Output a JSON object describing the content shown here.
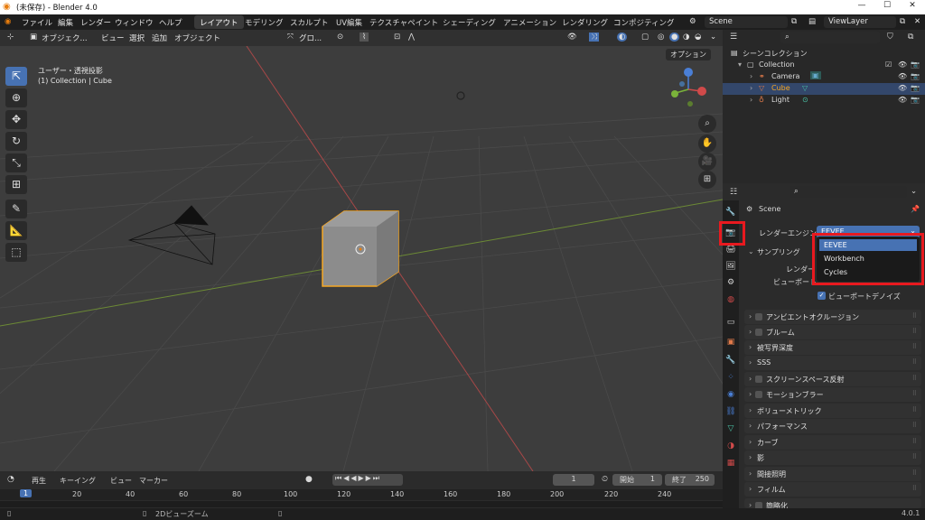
{
  "window": {
    "title": "(未保存) - Blender 4.0",
    "controls": [
      "—",
      "☐",
      "✕"
    ]
  },
  "menu": [
    "ファイル",
    "編集",
    "レンダー",
    "ウィンドウ",
    "ヘルプ"
  ],
  "workspaces": [
    "レイアウト",
    "モデリング",
    "スカルプト",
    "UV編集",
    "テクスチャペイント",
    "シェーディング",
    "アニメーション",
    "レンダリング",
    "コンポジティング"
  ],
  "active_workspace": "レイアウト",
  "scene_name": "Scene",
  "view_layer": "ViewLayer",
  "viewport_header": {
    "mode": "オブジェク...",
    "items": [
      "ビュー",
      "選択",
      "追加",
      "オブジェクト"
    ],
    "transform": "グロ..."
  },
  "viewport": {
    "view_name": "ユーザー・透視投影",
    "context": "(1) Collection | Cube",
    "options_label": "オプション"
  },
  "outliner": {
    "root": "シーンコレクション",
    "collection": "Collection",
    "items": [
      {
        "name": "Camera",
        "color": "#e07a4a"
      },
      {
        "name": "Cube",
        "color": "#e07a4a"
      },
      {
        "name": "Light",
        "color": "#e07a4a"
      }
    ]
  },
  "properties": {
    "scene": "Scene",
    "engine_label": "レンダーエンジン",
    "engine_value": "EEVEE",
    "engine_options": [
      "EEVEE",
      "Workbench",
      "Cycles"
    ],
    "sampling": "サンプリング",
    "render_label": "レンダー",
    "viewport_label": "ビューポート",
    "denoise": "ビューポートデノイズ",
    "panels": [
      {
        "label": "アンビエントオクルージョン",
        "checkbox": true
      },
      {
        "label": "ブルーム",
        "checkbox": true
      },
      {
        "label": "被写界深度",
        "checkbox": false
      },
      {
        "label": "SSS",
        "checkbox": false
      },
      {
        "label": "スクリーンスペース反射",
        "checkbox": true
      },
      {
        "label": "モーションブラー",
        "checkbox": true
      },
      {
        "label": "ボリューメトリック",
        "checkbox": false
      },
      {
        "label": "パフォーマンス",
        "checkbox": false
      },
      {
        "label": "カーブ",
        "checkbox": false
      },
      {
        "label": "影",
        "checkbox": false
      },
      {
        "label": "間接照明",
        "checkbox": false
      },
      {
        "label": "フィルム",
        "checkbox": false
      },
      {
        "label": "簡略化",
        "checkbox": true
      }
    ]
  },
  "timeline": {
    "menus": [
      "再生",
      "キーイング",
      "ビュー",
      "マーカー"
    ],
    "current_frame": "1",
    "start_label": "開始",
    "start": "1",
    "end_label": "終了",
    "end": "250",
    "ticks": [
      "1",
      "20",
      "40",
      "60",
      "80",
      "100",
      "120",
      "140",
      "160",
      "180",
      "200",
      "220",
      "240"
    ]
  },
  "status": {
    "hint": "2Dビューズーム",
    "version": "4.0.1"
  },
  "colors": {
    "accent": "#4772b3",
    "selection": "#f5a623",
    "highlight": "#e8191f"
  }
}
